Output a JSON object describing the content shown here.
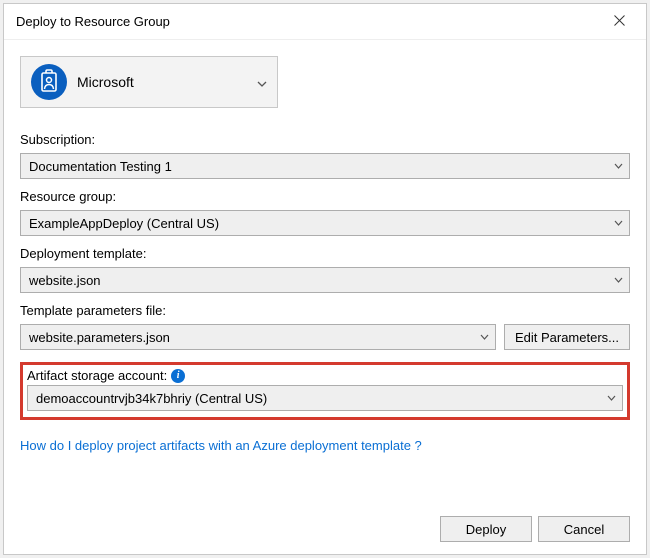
{
  "window": {
    "title": "Deploy to Resource Group"
  },
  "account": {
    "name": "Microsoft"
  },
  "fields": {
    "subscription": {
      "label": "Subscription:",
      "value": "Documentation Testing 1"
    },
    "resource_group": {
      "label": "Resource group:",
      "value": "ExampleAppDeploy (Central US)"
    },
    "template": {
      "label": "Deployment template:",
      "value": "website.json"
    },
    "params": {
      "label": "Template parameters file:",
      "value": "website.parameters.json",
      "edit_label": "Edit Parameters..."
    },
    "artifact": {
      "label": "Artifact storage account:",
      "value": "demoaccountrvjb34k7bhriy (Central US)"
    }
  },
  "help_link": "How do I deploy project artifacts with an Azure deployment template ?",
  "footer": {
    "deploy": "Deploy",
    "cancel": "Cancel"
  }
}
